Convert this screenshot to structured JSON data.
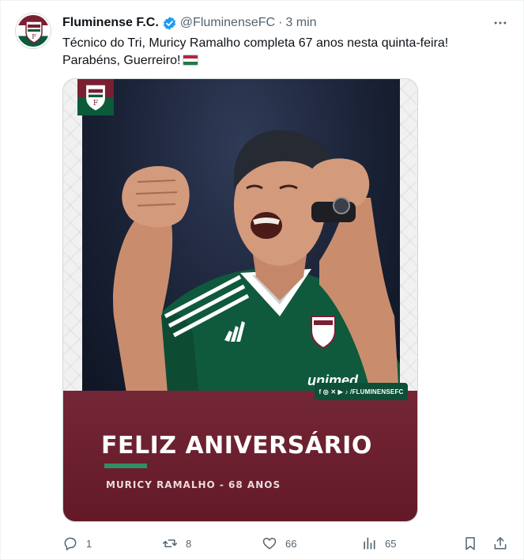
{
  "tweet": {
    "author_name": "Fluminense F.C.",
    "handle": "@FluminenseFC",
    "separator": "·",
    "time": "3 min",
    "text_line1": "Técnico do Tri, Muricy Ramalho completa 67 anos nesta quinta-feira!",
    "text_line2": "Parabéns, Guerreiro!",
    "flag_icon": "fluminense-flag-emoji"
  },
  "image": {
    "social_handle": "f ◎ ✕ ▶ ♪ /FLUMINENSEFC",
    "headline": "FELIZ ANIVERSÁRIO",
    "subhead": "MURICY RAMALHO - 68 ANOS",
    "sponsor": "unimed"
  },
  "actions": {
    "replies": "1",
    "retweets": "8",
    "likes": "66",
    "views": "65"
  },
  "colors": {
    "verified": "#1d9bf0",
    "maroon": "#6c1b2b",
    "green": "#0b5a3a",
    "icon_gray": "#536471"
  }
}
